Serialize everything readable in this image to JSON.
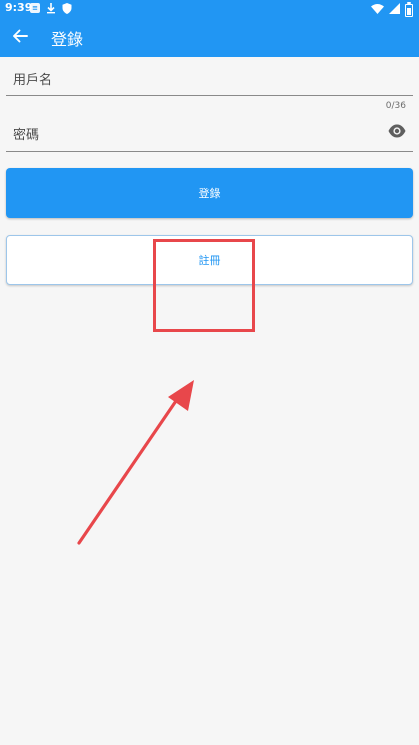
{
  "status_bar": {
    "time": "9:39",
    "left_icons": [
      "notification-icon",
      "download-icon",
      "shield-icon"
    ],
    "right_icons": [
      "wifi-icon",
      "signal-icon",
      "battery-icon"
    ]
  },
  "app_bar": {
    "back_icon": "arrow-back-icon",
    "title": "登錄"
  },
  "form": {
    "username": {
      "label": "用戶名",
      "value": "",
      "counter": "0/36"
    },
    "password": {
      "label": "密碼",
      "value": "",
      "toggle_icon": "eye-icon"
    },
    "login_button": {
      "label": "登錄"
    },
    "register_button": {
      "label": "註冊"
    }
  },
  "annotation": {
    "highlight_color": "#e8474b",
    "arrow_color": "#e8474b"
  },
  "colors": {
    "primary": "#2196f3",
    "background": "#f6f6f6"
  }
}
